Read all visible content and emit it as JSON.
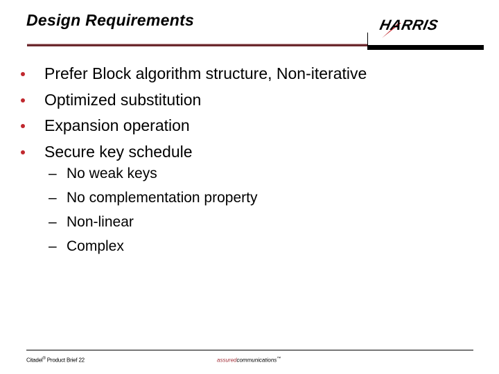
{
  "slide": {
    "title": "Design Requirements",
    "logo_text": "HARRIS",
    "bullets": [
      "Prefer Block algorithm structure, Non-iterative",
      "Optimized substitution",
      "Expansion operation",
      "Secure key schedule"
    ],
    "sub_bullets": [
      "No weak keys",
      "No complementation property",
      "Non-linear",
      "Complex"
    ],
    "dash_glyph": "–"
  },
  "footer": {
    "product": "Citadel",
    "registered_mark": "®",
    "brief": " Product Brief 22",
    "tagline_accent": "assured",
    "tagline_rest": "communications",
    "trademark": "™"
  },
  "colors": {
    "bullet": "#c0282e",
    "title_rule": "#6b2a2e",
    "tagline_accent": "#a3313a",
    "logo_swoosh": "#c0282e"
  }
}
